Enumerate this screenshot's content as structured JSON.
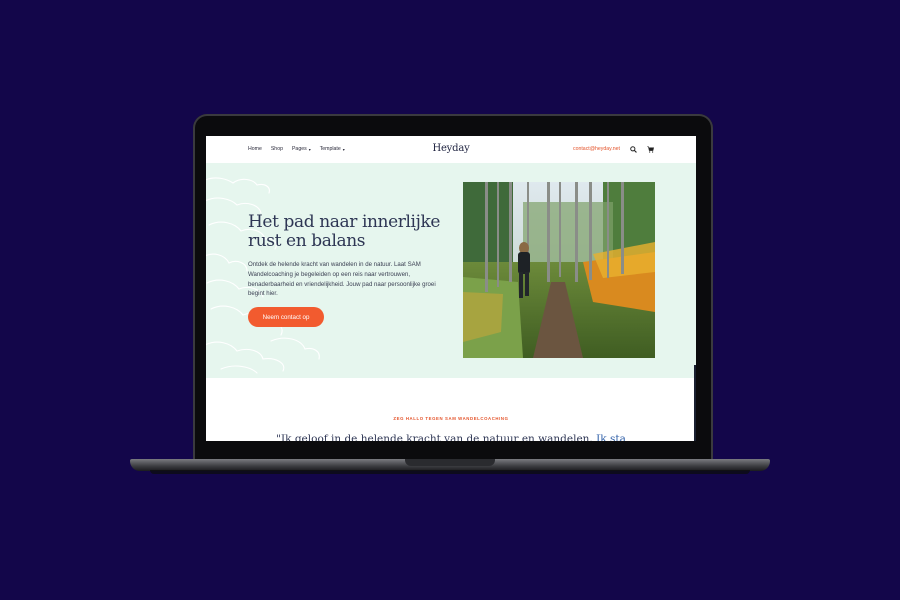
{
  "colors": {
    "background": "#13064a",
    "accent": "#f25b2f",
    "hero_bg": "#e6f6ee",
    "heading": "#2e3654"
  },
  "header": {
    "logo": "Heyday",
    "nav": [
      {
        "label": "Home",
        "has_dropdown": false
      },
      {
        "label": "Shop",
        "has_dropdown": false
      },
      {
        "label": "Pages",
        "has_dropdown": true
      },
      {
        "label": "Template",
        "has_dropdown": true
      }
    ],
    "email": "contact@heyday.net",
    "icons": [
      "search-icon",
      "cart-icon"
    ]
  },
  "hero": {
    "title": "Het pad naar innerlijke rust en balans",
    "text": "Ontdek de helende kracht van wandelen in de natuur. Laat SAM Wandelcoaching je begeleiden op een reis naar vertrouwen, benaderbaarheid en vriendelijkheid. Jouw pad naar persoonlijke groei begint hier.",
    "cta": "Neem contact op"
  },
  "intro": {
    "eyebrow": "ZEG HALLO TEGEN SAM WANDELCOACHING",
    "quote_main": "\"Ik geloof in de helende kracht van de natuur en wandelen. ",
    "quote_highlight": "Ik sta"
  }
}
